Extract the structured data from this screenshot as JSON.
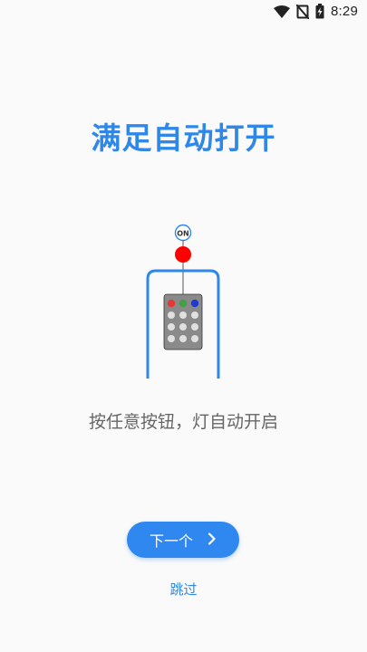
{
  "status_bar": {
    "time": "8:29",
    "icons": [
      "wifi-icon",
      "no-sim-icon",
      "battery-charging-icon"
    ]
  },
  "onboarding": {
    "title": "满足自动打开",
    "description": "按任意按钮，灯自动开启",
    "illustration": {
      "on_badge": "ON",
      "indicator_colors": [
        "#e53935",
        "#43a047",
        "#1e3ad1"
      ],
      "accent_color": "#2f87e8",
      "light_color": "#ff0000"
    },
    "next_button": {
      "label": "下一个",
      "icon": "chevron-right-icon"
    },
    "skip_label": "跳过"
  }
}
